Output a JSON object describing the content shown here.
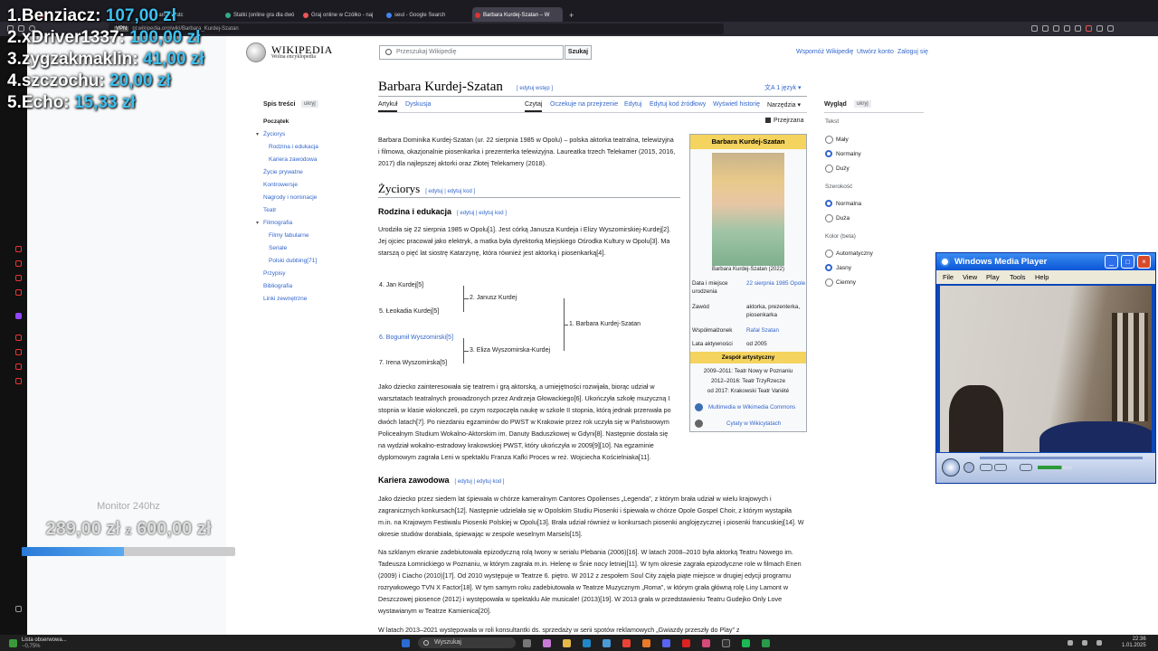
{
  "browser": {
    "tabs": [
      {
        "label": "",
        "color": "#e33"
      },
      {
        "label": "eam - Watc",
        "color": "#9146ff"
      },
      {
        "label": "Statki (online gra dla dwó",
        "color": "#3a8"
      },
      {
        "label": "Graj online w Czółko - naj",
        "color": "#e55"
      },
      {
        "label": "seul - Google Search",
        "color": "#4285f4"
      },
      {
        "label": "Barbara Kurdej-Szatan – W",
        "color": "#d33"
      }
    ],
    "url": "pl.wikipedia.org/wiki/Barbara_Kurdej-Szatan",
    "url_badge": "VPN",
    "new_tab": "+"
  },
  "overlay": {
    "donors": [
      {
        "rank": "1.",
        "name": "Benziacz:",
        "amount": "107,00 zł"
      },
      {
        "rank": "2.",
        "name": "xDriver1337:",
        "amount": "100,00 zł"
      },
      {
        "rank": "3.",
        "name": "zygzakmaklin:",
        "amount": "41,00 zł"
      },
      {
        "rank": "4.",
        "name": "szczochu:",
        "amount": "20,00 zł"
      },
      {
        "rank": "5.",
        "name": "Echo:",
        "amount": "15,33 zł"
      }
    ],
    "goal_label": "Monitor 240hz",
    "goal_current": "289,00 zł",
    "goal_z": "z",
    "goal_target": "600,00 zł",
    "goal_fraction": 0.48
  },
  "wiki": {
    "logo_title": "WIKIPEDIA",
    "logo_subtitle": "Wolna encyklopedia",
    "search_placeholder": "Przeszukaj Wikipedię",
    "search_button": "Szukaj",
    "header_links": [
      "Wspomóż Wikipedię",
      "Utwórz konto",
      "Zaloguj się"
    ],
    "title": "Barbara Kurdej-Szatan",
    "title_edit": "[ edytuj wstęp ]",
    "languages": "1 język",
    "tabs_left": [
      "Artykuł",
      "Dyskusja"
    ],
    "tabs_right": [
      "Czytaj",
      "Oczekuje na przejrzenie",
      "Edytuj",
      "Edytuj kod źródłowy",
      "Wyświetl historię",
      "Narzędzia"
    ],
    "reviewed": "Przejrzana",
    "toc": {
      "heading": "Spis treści",
      "hide": "ukryj",
      "items": [
        {
          "label": "Początek",
          "level": 0
        },
        {
          "label": "Życiorys",
          "level": 1
        },
        {
          "label": "Rodzina i edukacja",
          "level": 2
        },
        {
          "label": "Kariera zawodowa",
          "level": 2
        },
        {
          "label": "Życie prywatne",
          "level": 1
        },
        {
          "label": "Kontrowersje",
          "level": 1
        },
        {
          "label": "Nagrody i nominacje",
          "level": 1
        },
        {
          "label": "Teatr",
          "level": 1
        },
        {
          "label": "Filmografia",
          "level": 1
        },
        {
          "label": "Filmy fabularne",
          "level": 2
        },
        {
          "label": "Seriale",
          "level": 2
        },
        {
          "label": "Polski dubbing[71]",
          "level": 2
        },
        {
          "label": "Przypisy",
          "level": 1
        },
        {
          "label": "Bibliografia",
          "level": 1
        },
        {
          "label": "Linki zewnętrzne",
          "level": 1
        }
      ]
    },
    "intro": "Barbara Dominika Kurdej-Szatan (ur. 22 sierpnia 1985 w Opolu) – polska aktorka teatralna, telewizyjna i filmowa, okazjonalnie piosenkarka i prezenterka telewizyjna. Laureatka trzech Telekamer (2015, 2016, 2017) dla najlepszej aktorki oraz Złotej Telekamery (2018).",
    "h2_zyciorys": "Życiorys",
    "h2_edit": "[ edytuj | edytuj kod ]",
    "h3_rodzina": "Rodzina i edukacja",
    "para_rodzina": "Urodziła się 22 sierpnia 1985 w Opolu[1]. Jest córką Janusza Kurdeja i Elizy Wyszomirskiej-Kurdej[2]. Jej ojciec pracował jako elektryk, a matka była dyrektorką Miejskiego Ośrodka Kultury w Opolu[3]. Ma starszą o pięć lat siostrę Katarzynę, która również jest aktorką i piosenkarką[4].",
    "tree": {
      "n4": "4. Jan Kurdej[5]",
      "n5": "5. Łeokadia Kurdej[5]",
      "n6": "6. Bogumił Wyszomirski[5]",
      "n7": "7. Irena Wyszomirska[5]",
      "n2": "2. Janusz Kurdej",
      "n3": "3. Eliza Wyszomirska-Kurdej",
      "n1": "1. Barbara Kurdej-Szatan"
    },
    "para_dziecko": "Jako dziecko zainteresowała się teatrem i grą aktorską, a umiejętności rozwijała, biorąc udział w warsztatach teatralnych prowadzonych przez Andrzeja Głowackiego[6]. Ukończyła szkołę muzyczną I stopnia w klasie wiolonczeli, po czym rozpoczęła naukę w szkole II stopnia, którą jednak przerwała po dwóch latach[7]. Po niezdaniu egzaminów do PWST w Krakowie przez rok uczyła się w Państwowym Policealnym Studium Wokalno-Aktorskim im. Danuty Baduszkowej w Gdyni[8]. Następnie dostała się na wydział wokalno-estradowy krakowskiej PWST, który ukończyła w 2009[9][10]. Na egzaminie dyplomowym zagrała Leni w spektaklu Franza Kafki Proces w reż. Wojciecha Kościelniaka[11].",
    "h3_kariera": "Kariera zawodowa",
    "para_kariera1": "Jako dziecko przez siedem lat śpiewała w chórze kameralnym Cantores Opolienses „Legenda”, z którym brała udział w wielu krajowych i zagranicznych konkursach[12]. Następnie udzielała się w Opolskim Studiu Piosenki i śpiewała w chórze Opole Gospel Choir, z którym wystąpiła m.in. na Krajowym Festiwalu Piosenki Polskiej w Opolu[13]. Brała udział również w konkursach piosenki anglojęzycznej i piosenki francuskiej[14]. W okresie studiów dorabiała, śpiewając w zespole weselnym Marsels[15].",
    "para_kariera2": "Na szklanym ekranie zadebiutowała epizodyczną rolą Iwony w serialu Plebania (2006)[16]. W latach 2008–2010 była aktorką Teatru Nowego im. Tadeusza Łomnickiego w Poznaniu, w którym zagrała m.in. Helenę w Śnie nocy letniej[11]. W tym okresie zagrała epizodyczne role w filmach Enen (2009) i Ciacho (2010)[17]. Od 2010 występuje w Teatrze 6. piętro. W 2012 z zespołem Soul City zajęła piąte miejsce w drugiej edycji programu rozrywkowego TVN X Factor[18]. W tym samym roku zadebiutowała w Teatrze Muzycznym „Roma”, w którym grała główną rolę Liny Lamont w Deszczowej piosence (2012) i występowała w spektaklu Ale musicale! (2013)[19]. W 2013 grała w przedstawieniu Teatru Gudejko Only Love wystawianym w Teatrze Kamienica[20].",
    "para_kariera3": "W latach 2013–2021 występowała w roli konsultantki ds. sprzedaży w serii spotów reklamowych „Gwiazdy przeszły do Play” z",
    "infobox": {
      "title": "Barbara Kurdej-Szatan",
      "caption": "Barbara Kurdej-Szatan (2022)",
      "rows": [
        {
          "label": "Data i miejsce urodzenia",
          "value": "22 sierpnia 1985 Opole"
        },
        {
          "label": "Zawód",
          "value": "aktorka, prezenterka, piosenkarka"
        },
        {
          "label": "Współmałżonek",
          "value": "Rafał Szatan"
        },
        {
          "label": "Lata aktywności",
          "value": "od 2005"
        }
      ],
      "ensemble_heading": "Zespół artystyczny",
      "ensemble": [
        "2009–2011: Teatr Nowy w Poznaniu",
        "2012–2016: Teatr TrzyRzecze",
        "od 2017: Krakowski Teatr Variété"
      ],
      "links": [
        "Multimedia w Wikimedia Commons",
        "Cytaty w Wikicytatach"
      ]
    },
    "appearance": {
      "heading": "Wygląd",
      "hide": "ukryj",
      "text_label": "Tekst",
      "text_options": [
        "Mały",
        "Normalny",
        "Duży"
      ],
      "text_selected": 1,
      "width_label": "Szerokość",
      "width_options": [
        "Normalna",
        "Duża"
      ],
      "width_selected": 0,
      "color_label": "Kolor (beta)",
      "color_options": [
        "Automatyczny",
        "Jasny",
        "Ciemny"
      ],
      "color_selected": 1
    }
  },
  "wmp": {
    "title": "Windows Media Player",
    "menu": [
      "File",
      "View",
      "Play",
      "Tools",
      "Help"
    ]
  },
  "taskbar": {
    "weather_line1": "Lista obserwowa...",
    "weather_line2": "−0,75%",
    "search": "Wyszukaj",
    "time": "22:36",
    "date": "1.01.2025"
  }
}
